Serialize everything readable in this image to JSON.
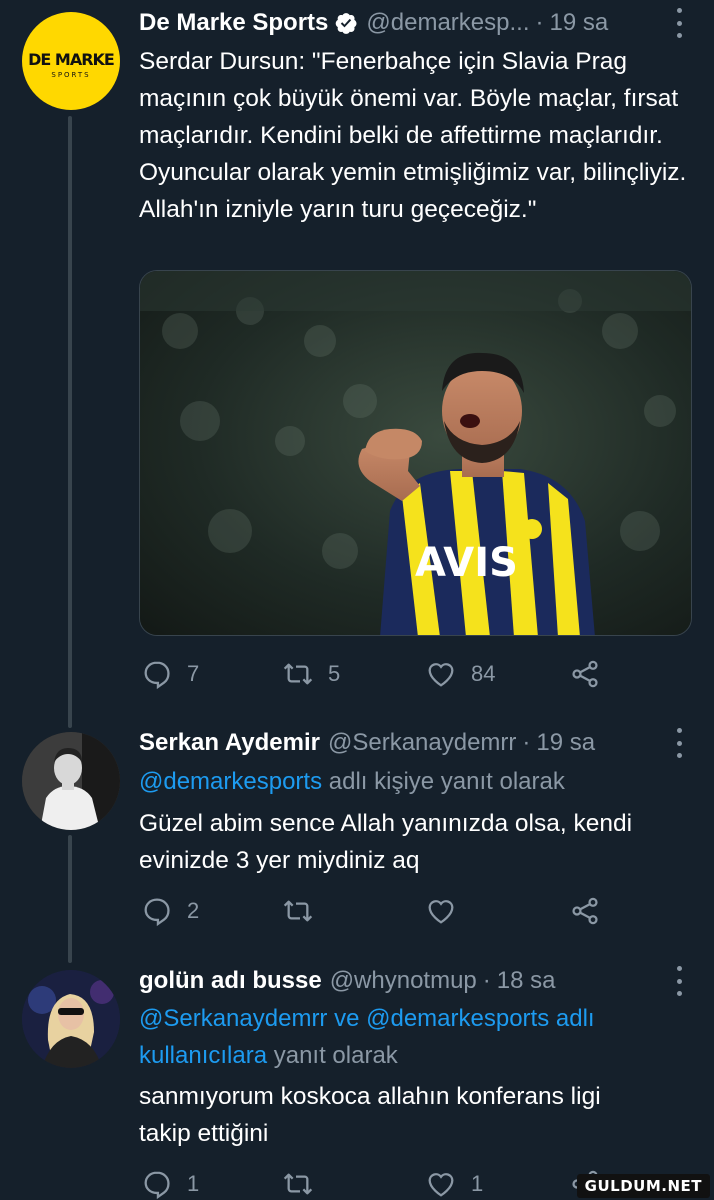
{
  "tweets": [
    {
      "author": "De Marke Sports",
      "handle": "@demarkesp...",
      "dot": "·",
      "time": "19 sa",
      "verified": true,
      "avatar_logo": {
        "line1": "DE MARKE",
        "line2": "SPORTS"
      },
      "text": "Serdar Dursun: \"Fenerbahçe için Slavia Prag maçının çok büyük önemi var. Böyle maçlar, fırsat maçlarıdır. Kendini belki de affettirme maçlarıdır. Oyuncular olarak yemin etmişliğimiz var, bilinçliyiz. Allah'ın izniyle yarın turu geçeceğiz.\"",
      "media": {
        "jersey_text": "AVIS"
      },
      "replies": "7",
      "retweets": "5",
      "likes": "84"
    },
    {
      "author": "Serkan Aydemir",
      "handle": "@Serkanaydemrr",
      "dot": "·",
      "time": "19 sa",
      "reply_to_mention": "@demarkesports",
      "reply_to_suffix": " adlı kişiye yanıt olarak",
      "text": "Güzel abim sence Allah yanınızda olsa, kendi evinizde 3 yer miydiniz aq",
      "replies": "2",
      "retweets": "",
      "likes": ""
    },
    {
      "author": "golün adı busse",
      "handle": "@whynotmup",
      "dot": "·",
      "time": "18 sa",
      "reply_to_mention1": "@Serkanaydemrr",
      "reply_to_ve": " ve ",
      "reply_to_mention2": "@demarkesports",
      "reply_to_link_suffix": " adlı kullanıcılara",
      "reply_to_suffix": " yanıt olarak",
      "text": "sanmıyorum koskoca allahın konferans ligi takip ettiğini",
      "replies": "1",
      "retweets": "",
      "likes": "1"
    }
  ],
  "watermark": "GULDUM.NET",
  "colors": {
    "background": "#15202b",
    "secondary_text": "#8b98a5",
    "link": "#1d9bf0",
    "verified": "#ffffff",
    "logo_yellow": "#ffd800"
  },
  "icons": [
    "reply-icon",
    "retweet-icon",
    "like-icon",
    "share-icon",
    "verified-icon",
    "more-icon"
  ]
}
